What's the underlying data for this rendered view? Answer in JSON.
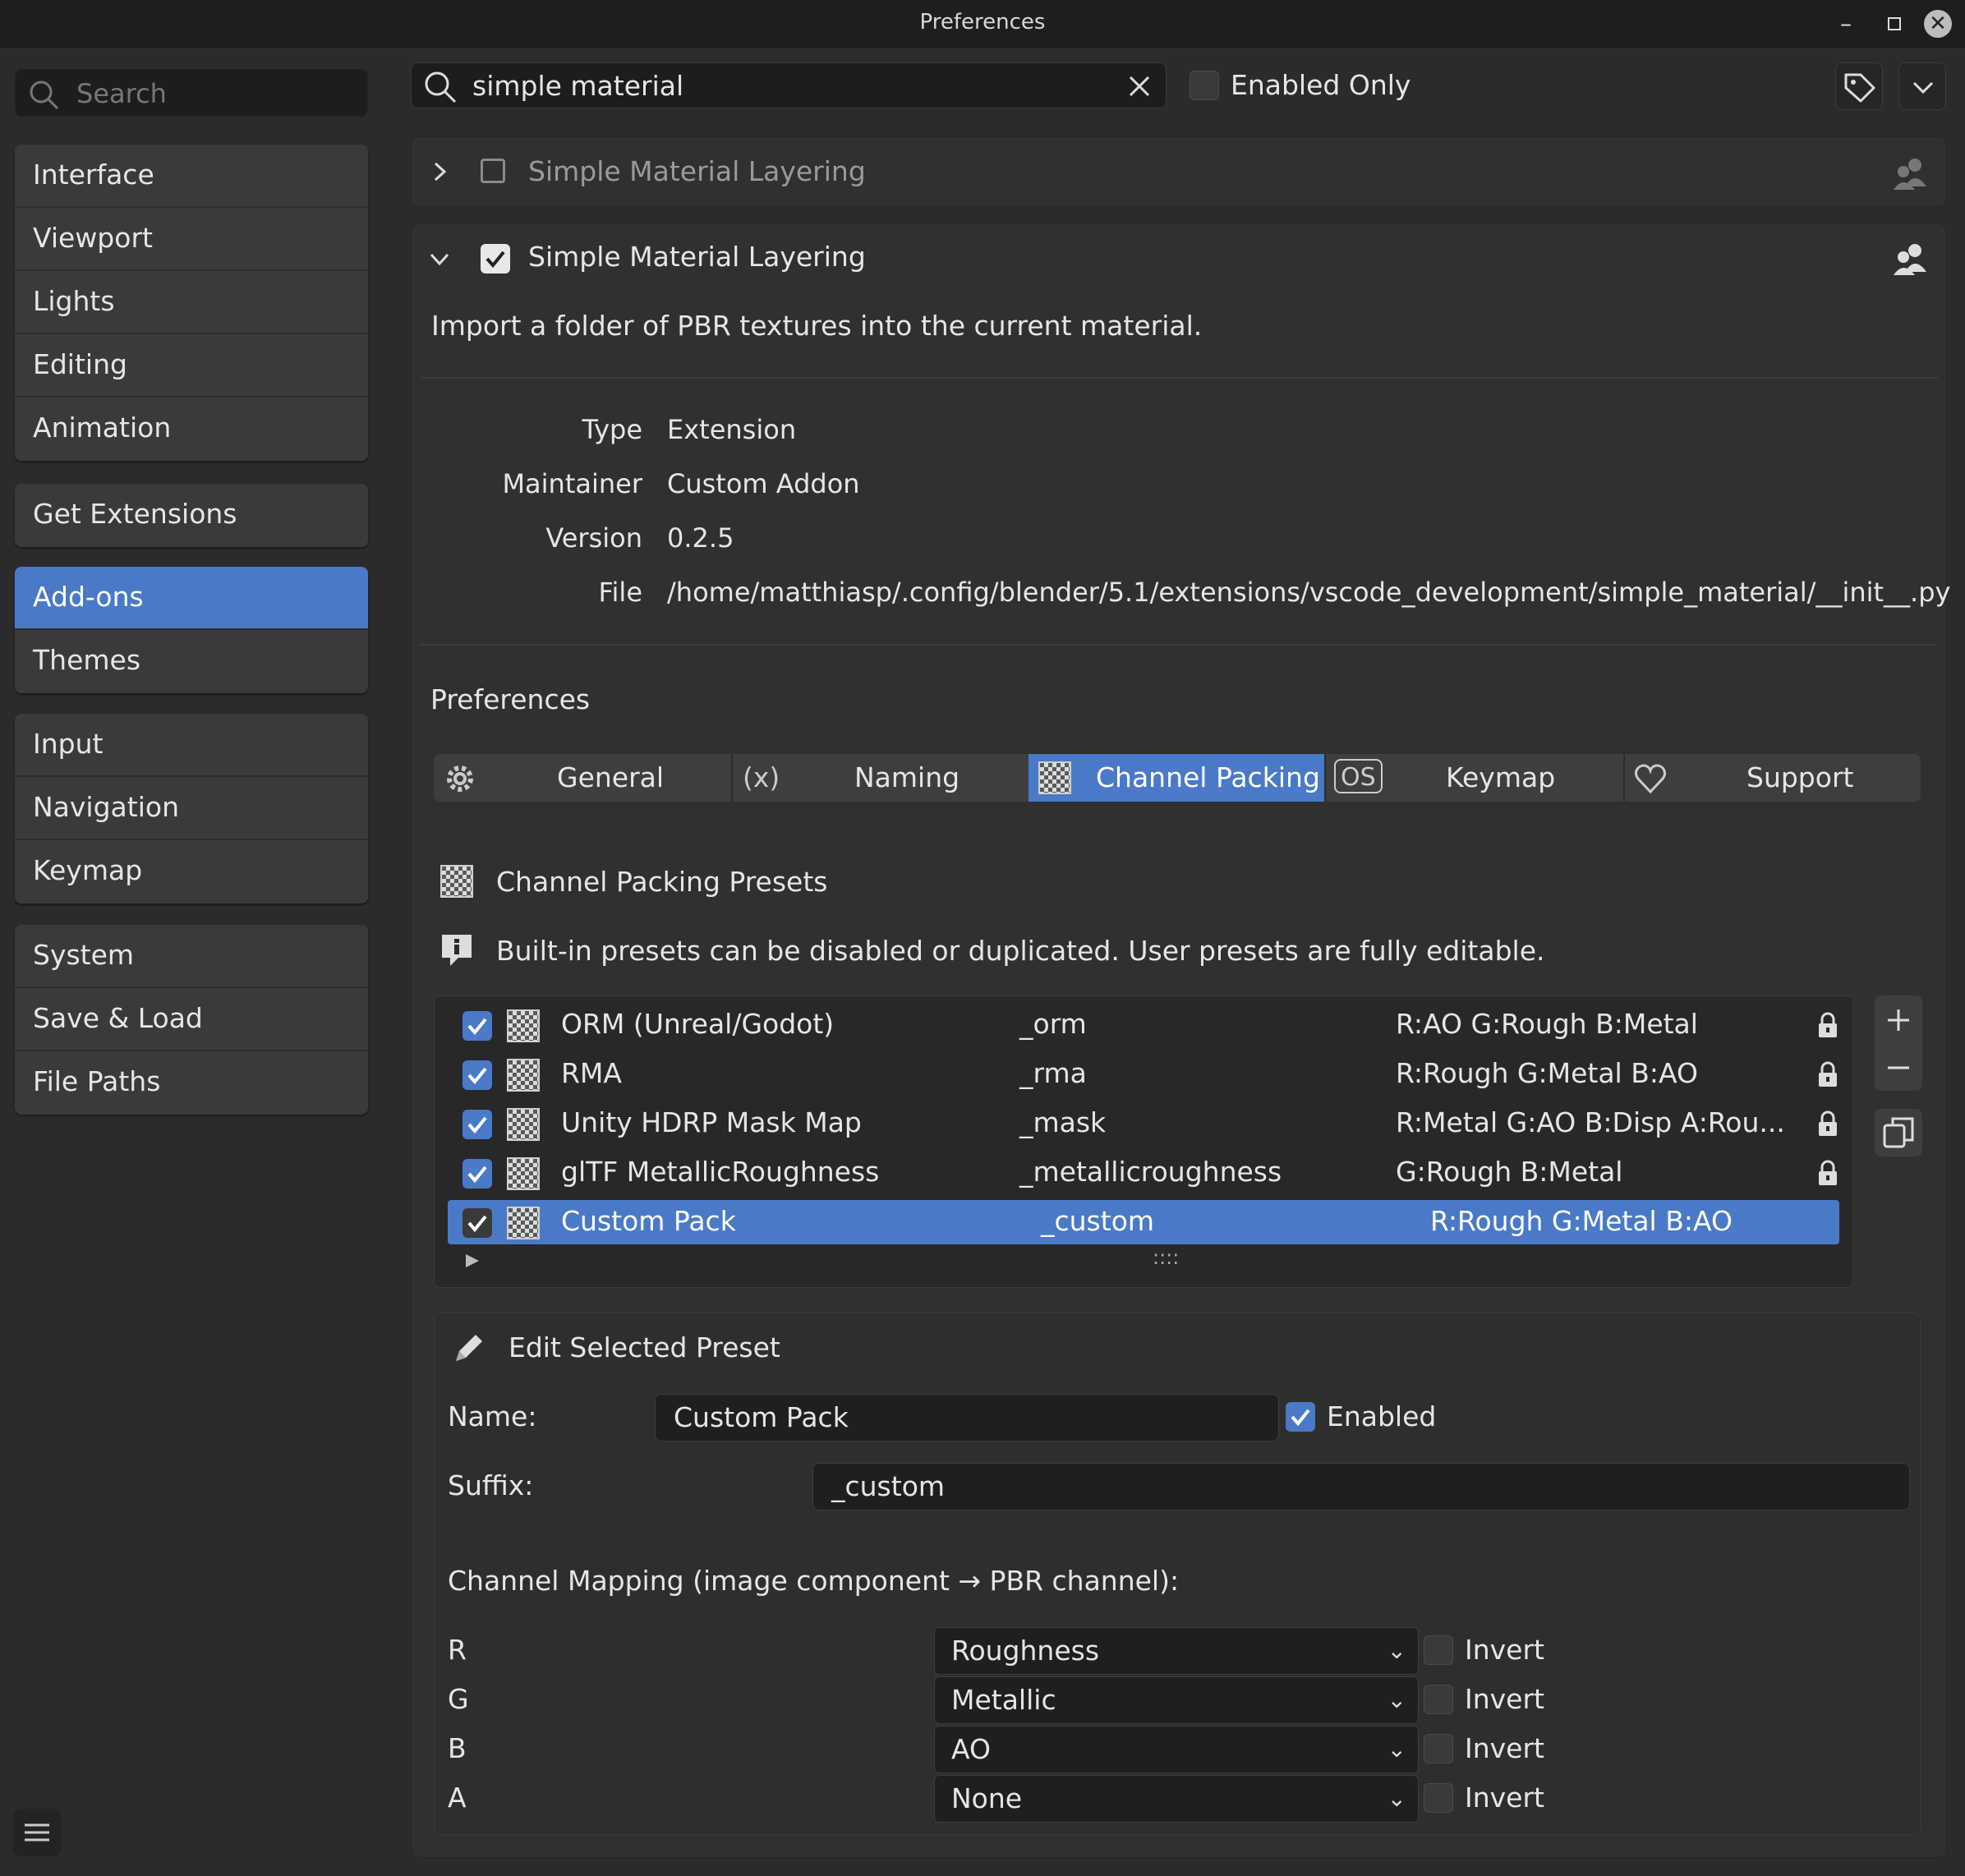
{
  "window": {
    "title": "Preferences"
  },
  "sidebar": {
    "search_placeholder": "Search",
    "groups": [
      [
        "Interface",
        "Viewport",
        "Lights",
        "Editing",
        "Animation"
      ],
      [
        "Get Extensions"
      ],
      [
        "Add-ons",
        "Themes"
      ],
      [
        "Input",
        "Navigation",
        "Keymap"
      ],
      [
        "System",
        "Save & Load",
        "File Paths"
      ]
    ],
    "active": "Add-ons"
  },
  "toolbar": {
    "search_value": "simple material",
    "enabled_only_label": "Enabled Only",
    "enabled_only_checked": false
  },
  "addon_collapsed": {
    "name": "Simple Material Layering",
    "enabled": false
  },
  "addon": {
    "name": "Simple Material Layering",
    "enabled": true,
    "description": "Import a folder of PBR textures into the current material.",
    "info": [
      {
        "label": "Type",
        "value": "Extension"
      },
      {
        "label": "Maintainer",
        "value": "Custom Addon"
      },
      {
        "label": "Version",
        "value": "0.2.5"
      },
      {
        "label": "File",
        "value": "/home/matthiasp/.config/blender/5.1/extensions/vscode_development/simple_material/__init__.py"
      }
    ],
    "preferences_heading": "Preferences"
  },
  "tabs": [
    {
      "label": "General",
      "icon": "gear-icon",
      "icon_text": ""
    },
    {
      "label": "Naming",
      "icon": "variable-icon",
      "icon_text": "(x)"
    },
    {
      "label": "Channel Packing",
      "icon": "checker-icon",
      "icon_text": ""
    },
    {
      "label": "Keymap",
      "icon": "os-key-icon",
      "icon_text": "OS"
    },
    {
      "label": "Support",
      "icon": "heart-icon",
      "icon_text": ""
    }
  ],
  "active_tab": "Channel Packing",
  "presets": {
    "heading": "Channel Packing Presets",
    "info": "Built-in presets can be disabled or duplicated. User presets are fully editable.",
    "rows": [
      {
        "name": "ORM (Unreal/Godot)",
        "suffix": "_orm",
        "channels": "R:AO  G:Rough  B:Metal",
        "enabled": true,
        "locked": true
      },
      {
        "name": "RMA",
        "suffix": "_rma",
        "channels": "R:Rough  G:Metal  B:AO",
        "enabled": true,
        "locked": true
      },
      {
        "name": "Unity HDRP Mask Map",
        "suffix": "_mask",
        "channels": "R:Metal  G:AO  B:Disp  A:Rou...",
        "enabled": true,
        "locked": true
      },
      {
        "name": "glTF MetallicRoughness",
        "suffix": "_metallicroughness",
        "channels": "G:Rough  B:Metal",
        "enabled": true,
        "locked": true
      },
      {
        "name": "Custom Pack",
        "suffix": "_custom",
        "channels": "R:Rough  G:Metal  B:AO",
        "enabled": true,
        "locked": false,
        "selected": true
      }
    ],
    "grip": "::::"
  },
  "edit": {
    "heading": "Edit Selected Preset",
    "name_label": "Name:",
    "name_value": "Custom Pack",
    "enabled_label": "Enabled",
    "suffix_label": "Suffix:",
    "suffix_value": "_custom",
    "mapping_heading": "Channel Mapping  (image component  →  PBR channel):",
    "mapping": [
      {
        "channel": "R",
        "value": "Roughness",
        "invert_label": "Invert",
        "invert": false
      },
      {
        "channel": "G",
        "value": "Metallic",
        "invert_label": "Invert",
        "invert": false
      },
      {
        "channel": "B",
        "value": "AO",
        "invert_label": "Invert",
        "invert": false
      },
      {
        "channel": "A",
        "value": "None",
        "invert_label": "Invert",
        "invert": false
      }
    ]
  },
  "colors": {
    "accent": "#4a7ac7",
    "background": "#2b2b2b",
    "titlebar": "#1e1e1e"
  }
}
